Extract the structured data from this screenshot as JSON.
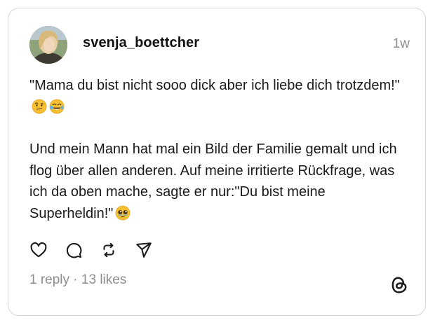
{
  "post": {
    "username": "svenja_boettcher",
    "time_ago": "1w",
    "paragraph1": "\"Mama du bist nicht sooo dick aber ich liebe dich trotzdem!\"",
    "paragraph2": "Und mein Mann hat mal ein Bild der Familie gemalt und ich flog über allen anderen. Auf meine irritierte Rückfrage, was ich da oben mache, sagte er nur:\"Du bist meine Superheldin!\"",
    "stats": "1 reply · 13 likes"
  },
  "icons": {
    "like": "heart-icon",
    "reply": "comment-bubble-icon",
    "repost": "repost-icon",
    "share": "send-icon",
    "brand": "threads-logo-icon",
    "emoji1": "face-with-raised-eyebrow-emoji",
    "emoji2": "face-with-tears-of-joy-emoji",
    "emoji3": "pleading-face-emoji"
  },
  "colors": {
    "text": "#1a1a1a",
    "muted": "#8e8e8e",
    "border": "#d6d6d6"
  }
}
